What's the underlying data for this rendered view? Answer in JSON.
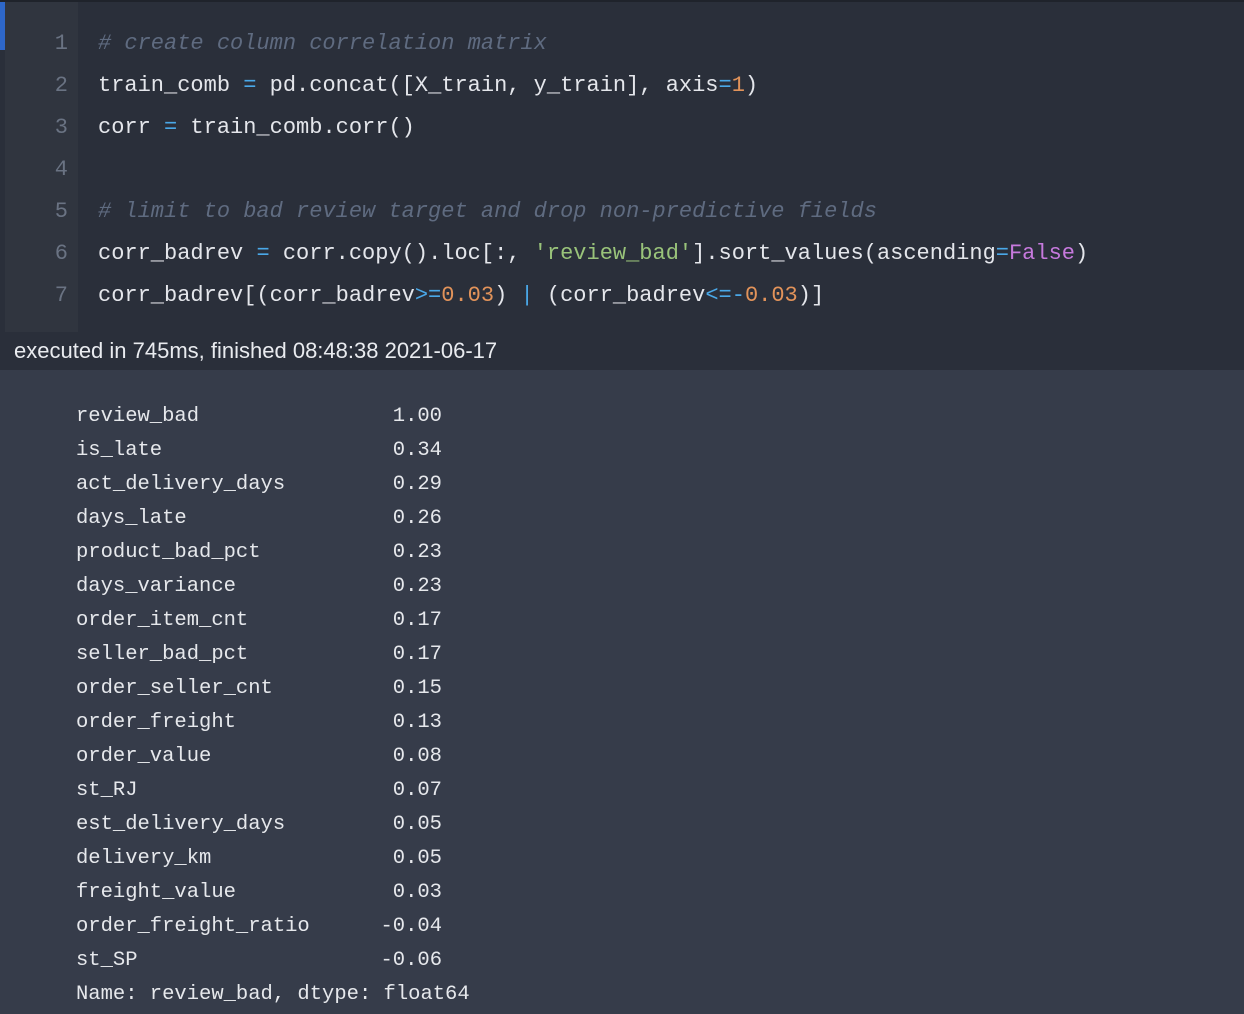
{
  "code_cell": {
    "line_numbers": [
      "1",
      "2",
      "3",
      "4",
      "5",
      "6",
      "7"
    ],
    "lines": {
      "l1": {
        "comment": "# create column correlation matrix"
      },
      "l2": {
        "a": "train_comb ",
        "op1": "=",
        "b": " pd.concat([X_train, y_train], axis",
        "op2": "=",
        "num": "1",
        "c": ")"
      },
      "l3": {
        "a": "corr ",
        "op1": "=",
        "b": " train_comb.corr()"
      },
      "l5": {
        "comment": "# limit to bad review target and drop non-predictive fields"
      },
      "l6": {
        "a": "corr_badrev ",
        "op1": "=",
        "b": " corr.copy().loc[:, ",
        "str": "'review_bad'",
        "c": "].sort_values(ascending",
        "op2": "=",
        "kw": "False",
        "d": ")"
      },
      "l7": {
        "a": "corr_badrev[(corr_badrev",
        "op1": ">=",
        "num1": "0.03",
        "b": ") ",
        "op2": "|",
        "c": " (corr_badrev",
        "op3": "<=-",
        "num2": "0.03",
        "d": ")]"
      }
    }
  },
  "execution": {
    "status_text": "executed in 745ms, finished 08:48:38 2021-06-17"
  },
  "output": {
    "rows": [
      {
        "name": "review_bad",
        "value": "1.00"
      },
      {
        "name": "is_late",
        "value": "0.34"
      },
      {
        "name": "act_delivery_days",
        "value": "0.29"
      },
      {
        "name": "days_late",
        "value": "0.26"
      },
      {
        "name": "product_bad_pct",
        "value": "0.23"
      },
      {
        "name": "days_variance",
        "value": "0.23"
      },
      {
        "name": "order_item_cnt",
        "value": "0.17"
      },
      {
        "name": "seller_bad_pct",
        "value": "0.17"
      },
      {
        "name": "order_seller_cnt",
        "value": "0.15"
      },
      {
        "name": "order_freight",
        "value": "0.13"
      },
      {
        "name": "order_value",
        "value": "0.08"
      },
      {
        "name": "st_RJ",
        "value": "0.07"
      },
      {
        "name": "est_delivery_days",
        "value": "0.05"
      },
      {
        "name": "delivery_km",
        "value": "0.05"
      },
      {
        "name": "freight_value",
        "value": "0.03"
      },
      {
        "name": "order_freight_ratio",
        "value": "-0.04"
      },
      {
        "name": "st_SP",
        "value": "-0.06"
      }
    ],
    "footer": "Name: review_bad, dtype: float64"
  },
  "colors": {
    "code_background": "#2a2f3a",
    "output_background": "#363c4a",
    "cell_indicator": "#2e67c9",
    "comment": "#5f6b80",
    "operator": "#4aa8e8",
    "number": "#e2935a",
    "string": "#99c37a",
    "keyword": "#c679dd"
  }
}
